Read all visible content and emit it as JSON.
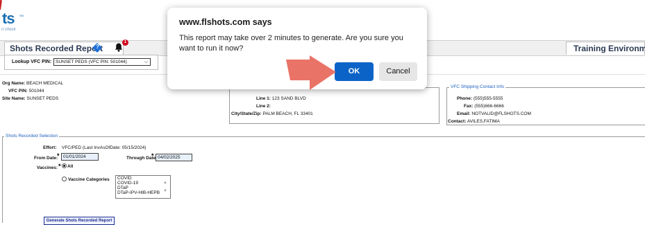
{
  "app": {
    "logo_text": "ts",
    "logo_tm": "SM",
    "logo_sub": "ri check",
    "page_title": "Shots Recorded Report",
    "help_icon_text": "?",
    "notification_count": "1",
    "environment": "Training Environment"
  },
  "lookup": {
    "label": "Lookup VFC PIN:",
    "selected": "SUNSET PEDS (VFC PIN: 501044)"
  },
  "org": {
    "org_name_label": "Org Name:",
    "org_name": "BEACH MEDICAL",
    "vfc_pin_label": "VFC PIN:",
    "vfc_pin": "501044",
    "site_name_label": "Site Name:",
    "site_name": "SUNSET PEDS"
  },
  "address": {
    "line1_label": "Line 1:",
    "line1": "123 SAND BLVD",
    "line2_label": "Line 2:",
    "line2": "",
    "city_label": "City/State/Zip:",
    "city": "PALM BEACH, FL 33401"
  },
  "shipping": {
    "legend": "VFC Shipping Contact Info",
    "phone_label": "Phone:",
    "phone": "(555)555-5555",
    "fax_label": "Fax:",
    "fax": "(555)666-6666",
    "email_label": "Email:",
    "email": "NOTVALID@FLSHOTS.COM",
    "contact_label": "Contact:",
    "contact": "AVILES,FATIMA"
  },
  "selection": {
    "legend": "Shots Recorded Selection",
    "effort_label": "Effort:",
    "effort_value": "VFC/PED (Last InvAsOfDate: 05/15/2024)",
    "from_label": "From Date:",
    "from_value": "01/01/2024",
    "through_label": "Through Date:",
    "through_value": "04/02/2025",
    "required_mark": "*",
    "vaccines_label": "Vaccines:",
    "all_label": "All",
    "categories_label": "Vaccine Categories",
    "categories": [
      "COVID",
      "COVID-19",
      "DTaP",
      "DTaP-IPV-HIB-HEPB"
    ],
    "generate_label": "Generate Shots Recorded Report"
  },
  "dialog": {
    "title": "www.flshots.com says",
    "message": "This report may take over 2 minutes to generate.  Are you sure you want to run it now?",
    "ok_label": "OK",
    "cancel_label": "Cancel"
  },
  "colors": {
    "ok_button": "#0b63c7",
    "arrow": "#e8675a",
    "link_blue": "#1f5fbf"
  }
}
